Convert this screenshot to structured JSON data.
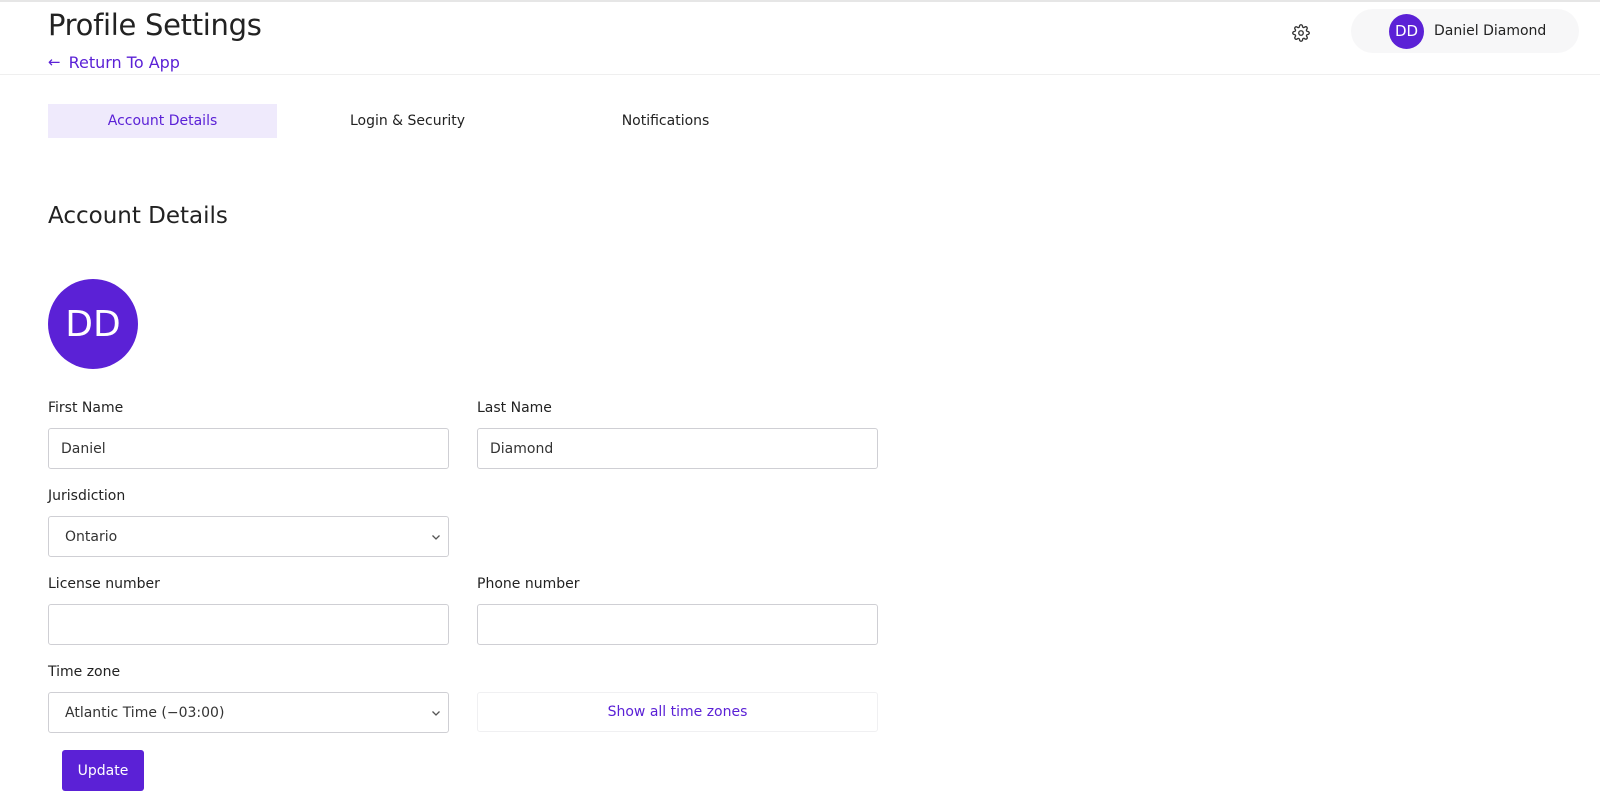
{
  "header": {
    "title": "Profile Settings",
    "return_label": "Return To App",
    "return_arrow": "←",
    "user": {
      "initials": "DD",
      "name": "Daniel Diamond"
    }
  },
  "tabs": [
    {
      "label": "Account Details",
      "active": true
    },
    {
      "label": "Login & Security",
      "active": false
    },
    {
      "label": "Notifications",
      "active": false
    }
  ],
  "account": {
    "section_title": "Account Details",
    "avatar_initials": "DD",
    "first_name": {
      "label": "First Name",
      "value": "Daniel"
    },
    "last_name": {
      "label": "Last Name",
      "value": "Diamond"
    },
    "jurisdiction": {
      "label": "Jurisdiction",
      "value": "Ontario"
    },
    "license": {
      "label": "License number",
      "value": ""
    },
    "phone": {
      "label": "Phone number",
      "value": ""
    },
    "timezone": {
      "label": "Time zone",
      "value": "Atlantic Time (−03:00)",
      "show_all_label": "Show all time zones"
    },
    "update_label": "Update"
  },
  "colors": {
    "accent": "#5b21d6",
    "tab_active_bg": "#efeafc"
  },
  "icons": {
    "settings": "gear-icon",
    "back": "arrow-left-icon",
    "dropdown": "chevron-down-icon"
  }
}
